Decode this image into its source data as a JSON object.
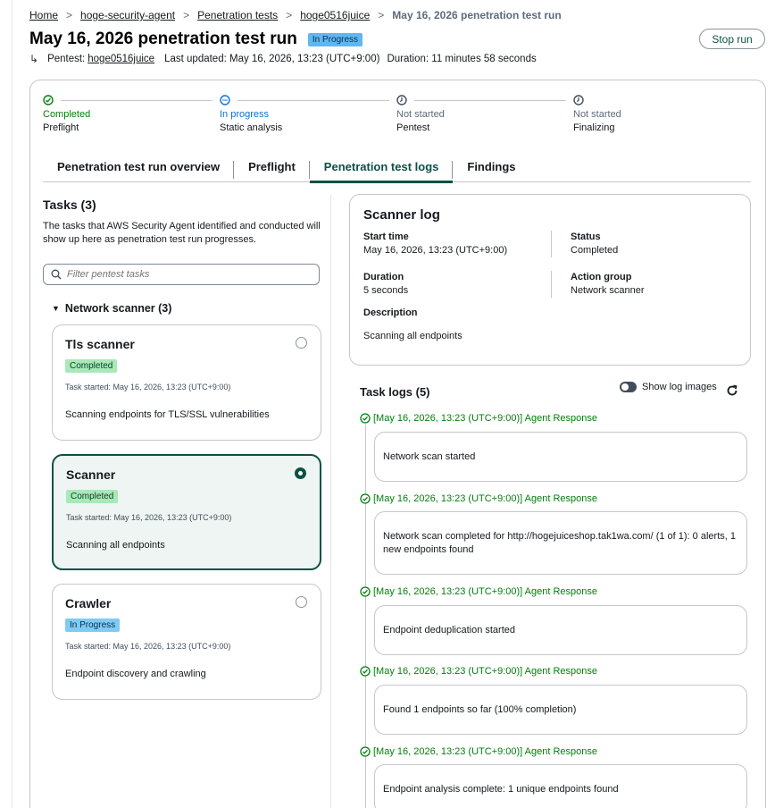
{
  "breadcrumb": {
    "items": [
      "Home",
      "hoge-security-agent",
      "Penetration tests",
      "hoge0516juice"
    ],
    "current": "May 16, 2026 penetration test run"
  },
  "header": {
    "title": "May 16, 2026 penetration test run",
    "status": "In Progress",
    "stop_label": "Stop run",
    "pentest_label": "Pentest:",
    "pentest_link": "hoge0516juice",
    "updated": "Last updated: May 16, 2026, 13:23 (UTC+9:00)",
    "duration": "Duration: 11 minutes 58 seconds"
  },
  "steps": [
    {
      "state": "Completed",
      "name": "Preflight",
      "icon": "check-circle-icon",
      "color": "#037f0c"
    },
    {
      "state": "In progress",
      "name": "Static analysis",
      "icon": "in-progress-icon",
      "color": "#0972d3"
    },
    {
      "state": "Not started",
      "name": "Pentest",
      "icon": "clock-icon",
      "color": "#5f6b7a"
    },
    {
      "state": "Not started",
      "name": "Finalizing",
      "icon": "clock-icon",
      "color": "#5f6b7a"
    }
  ],
  "tabs": [
    "Penetration test run overview",
    "Preflight",
    "Penetration test logs",
    "Findings"
  ],
  "active_tab": "Penetration test logs",
  "tasks": {
    "title": "Tasks (3)",
    "description": "The tasks that AWS Security Agent identified and conducted will show up here as penetration test run progresses.",
    "filter_placeholder": "Filter pentest tasks",
    "group": "Network scanner (3)",
    "items": [
      {
        "name": "Tls scanner",
        "status": "Completed",
        "started": "Task started: May 16, 2026, 13:23 (UTC+9:00)",
        "desc": "Scanning endpoints for TLS/SSL vulnerabilities"
      },
      {
        "name": "Scanner",
        "status": "Completed",
        "started": "Task started: May 16, 2026, 13:23 (UTC+9:00)",
        "desc": "Scanning all endpoints"
      },
      {
        "name": "Crawler",
        "status": "In Progress",
        "started": "Task started: May 16, 2026, 13:23 (UTC+9:00)",
        "desc": "Endpoint discovery and crawling"
      }
    ]
  },
  "scanner_log": {
    "title": "Scanner log",
    "start_time_label": "Start time",
    "start_time": "May 16, 2026, 13:23 (UTC+9:00)",
    "status_label": "Status",
    "status": "Completed",
    "duration_label": "Duration",
    "duration": "5 seconds",
    "action_group_label": "Action group",
    "action_group": "Network scanner",
    "description_label": "Description",
    "description": "Scanning all endpoints"
  },
  "task_logs": {
    "title": "Task logs (5)",
    "toggle_label": "Show log images",
    "entries": [
      {
        "head": "[May 16, 2026, 13:23 (UTC+9:00)] Agent Response",
        "text": "Network scan started"
      },
      {
        "head": "[May 16, 2026, 13:23 (UTC+9:00)] Agent Response",
        "text": "Network scan completed for http://hogejuiceshop.tak1wa.com/ (1 of 1): 0 alerts, 1 new endpoints found"
      },
      {
        "head": "[May 16, 2026, 13:23 (UTC+9:00)] Agent Response",
        "text": "Endpoint deduplication started"
      },
      {
        "head": "[May 16, 2026, 13:23 (UTC+9:00)] Agent Response",
        "text": "Found 1 endpoints so far (100% completion)"
      },
      {
        "head": "[May 16, 2026, 13:23 (UTC+9:00)] Agent Response",
        "text": "Endpoint analysis complete: 1 unique endpoints found"
      }
    ]
  },
  "colors": {
    "accent": "#0b5146",
    "success": "#037f0c",
    "info": "#0972d3"
  }
}
